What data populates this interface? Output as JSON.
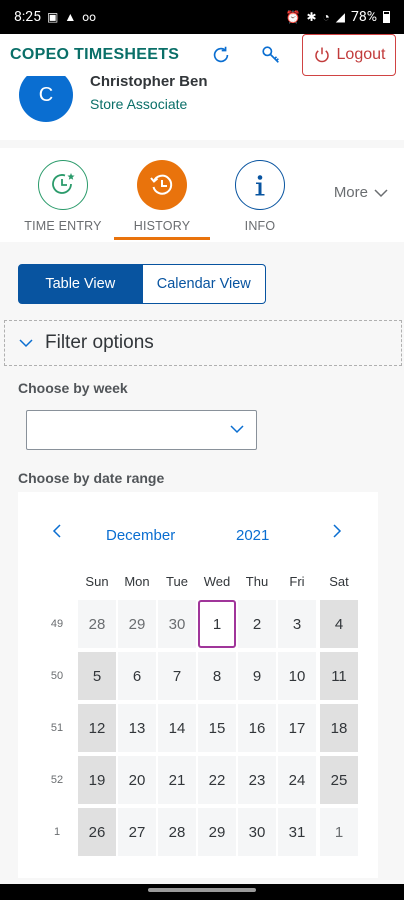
{
  "status": {
    "time": "8:25",
    "battery": "78%"
  },
  "header": {
    "title": "COPEO TIMESHEETS",
    "logout_label": "Logout"
  },
  "profile": {
    "initial": "C",
    "name": "Christopher Ben",
    "role": "Store Associate"
  },
  "tabs": [
    {
      "label": "TIME ENTRY",
      "icon": "time-entry-icon",
      "color": "#2b9b6b",
      "active": false
    },
    {
      "label": "HISTORY",
      "icon": "history-icon",
      "color": "#e9730c",
      "active": true
    },
    {
      "label": "INFO",
      "icon": "info-icon",
      "color": "#0854a0",
      "active": false
    }
  ],
  "more_label": "More",
  "views": {
    "table": "Table View",
    "calendar": "Calendar View"
  },
  "filter": {
    "title": "Filter options",
    "week_label": "Choose by week",
    "week_value": "",
    "range_label": "Choose by date range"
  },
  "calendar": {
    "month": "December",
    "year": "2021",
    "weekdays": [
      "Sun",
      "Mon",
      "Tue",
      "Wed",
      "Thu",
      "Fri",
      "Sat"
    ],
    "weeks": [
      {
        "num": "49",
        "days": [
          "28",
          "29",
          "30",
          "1",
          "2",
          "3",
          "4"
        ]
      },
      {
        "num": "50",
        "days": [
          "5",
          "6",
          "7",
          "8",
          "9",
          "10",
          "11"
        ]
      },
      {
        "num": "51",
        "days": [
          "12",
          "13",
          "14",
          "15",
          "16",
          "17",
          "18"
        ]
      },
      {
        "num": "52",
        "days": [
          "19",
          "20",
          "21",
          "22",
          "23",
          "24",
          "25"
        ]
      },
      {
        "num": "1",
        "days": [
          "26",
          "27",
          "28",
          "29",
          "30",
          "31",
          "1"
        ]
      }
    ],
    "today": "1"
  },
  "colors": {
    "accent": "#0854a0",
    "brand": "#0a6f68",
    "active_tab": "#e9730c",
    "logout": "#c23b3b",
    "today_border": "#a0359a"
  }
}
